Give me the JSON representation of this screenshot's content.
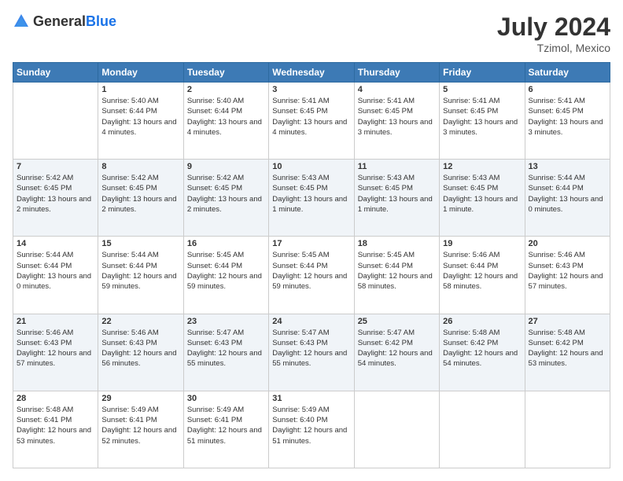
{
  "header": {
    "logo_general": "General",
    "logo_blue": "Blue",
    "month_year": "July 2024",
    "location": "Tzimol, Mexico"
  },
  "weekdays": [
    "Sunday",
    "Monday",
    "Tuesday",
    "Wednesday",
    "Thursday",
    "Friday",
    "Saturday"
  ],
  "weeks": [
    [
      {
        "day": "",
        "sunrise": "",
        "sunset": "",
        "daylight": ""
      },
      {
        "day": "1",
        "sunrise": "Sunrise: 5:40 AM",
        "sunset": "Sunset: 6:44 PM",
        "daylight": "Daylight: 13 hours and 4 minutes."
      },
      {
        "day": "2",
        "sunrise": "Sunrise: 5:40 AM",
        "sunset": "Sunset: 6:44 PM",
        "daylight": "Daylight: 13 hours and 4 minutes."
      },
      {
        "day": "3",
        "sunrise": "Sunrise: 5:41 AM",
        "sunset": "Sunset: 6:45 PM",
        "daylight": "Daylight: 13 hours and 4 minutes."
      },
      {
        "day": "4",
        "sunrise": "Sunrise: 5:41 AM",
        "sunset": "Sunset: 6:45 PM",
        "daylight": "Daylight: 13 hours and 3 minutes."
      },
      {
        "day": "5",
        "sunrise": "Sunrise: 5:41 AM",
        "sunset": "Sunset: 6:45 PM",
        "daylight": "Daylight: 13 hours and 3 minutes."
      },
      {
        "day": "6",
        "sunrise": "Sunrise: 5:41 AM",
        "sunset": "Sunset: 6:45 PM",
        "daylight": "Daylight: 13 hours and 3 minutes."
      }
    ],
    [
      {
        "day": "7",
        "sunrise": "Sunrise: 5:42 AM",
        "sunset": "Sunset: 6:45 PM",
        "daylight": "Daylight: 13 hours and 2 minutes."
      },
      {
        "day": "8",
        "sunrise": "Sunrise: 5:42 AM",
        "sunset": "Sunset: 6:45 PM",
        "daylight": "Daylight: 13 hours and 2 minutes."
      },
      {
        "day": "9",
        "sunrise": "Sunrise: 5:42 AM",
        "sunset": "Sunset: 6:45 PM",
        "daylight": "Daylight: 13 hours and 2 minutes."
      },
      {
        "day": "10",
        "sunrise": "Sunrise: 5:43 AM",
        "sunset": "Sunset: 6:45 PM",
        "daylight": "Daylight: 13 hours and 1 minute."
      },
      {
        "day": "11",
        "sunrise": "Sunrise: 5:43 AM",
        "sunset": "Sunset: 6:45 PM",
        "daylight": "Daylight: 13 hours and 1 minute."
      },
      {
        "day": "12",
        "sunrise": "Sunrise: 5:43 AM",
        "sunset": "Sunset: 6:45 PM",
        "daylight": "Daylight: 13 hours and 1 minute."
      },
      {
        "day": "13",
        "sunrise": "Sunrise: 5:44 AM",
        "sunset": "Sunset: 6:44 PM",
        "daylight": "Daylight: 13 hours and 0 minutes."
      }
    ],
    [
      {
        "day": "14",
        "sunrise": "Sunrise: 5:44 AM",
        "sunset": "Sunset: 6:44 PM",
        "daylight": "Daylight: 13 hours and 0 minutes."
      },
      {
        "day": "15",
        "sunrise": "Sunrise: 5:44 AM",
        "sunset": "Sunset: 6:44 PM",
        "daylight": "Daylight: 12 hours and 59 minutes."
      },
      {
        "day": "16",
        "sunrise": "Sunrise: 5:45 AM",
        "sunset": "Sunset: 6:44 PM",
        "daylight": "Daylight: 12 hours and 59 minutes."
      },
      {
        "day": "17",
        "sunrise": "Sunrise: 5:45 AM",
        "sunset": "Sunset: 6:44 PM",
        "daylight": "Daylight: 12 hours and 59 minutes."
      },
      {
        "day": "18",
        "sunrise": "Sunrise: 5:45 AM",
        "sunset": "Sunset: 6:44 PM",
        "daylight": "Daylight: 12 hours and 58 minutes."
      },
      {
        "day": "19",
        "sunrise": "Sunrise: 5:46 AM",
        "sunset": "Sunset: 6:44 PM",
        "daylight": "Daylight: 12 hours and 58 minutes."
      },
      {
        "day": "20",
        "sunrise": "Sunrise: 5:46 AM",
        "sunset": "Sunset: 6:43 PM",
        "daylight": "Daylight: 12 hours and 57 minutes."
      }
    ],
    [
      {
        "day": "21",
        "sunrise": "Sunrise: 5:46 AM",
        "sunset": "Sunset: 6:43 PM",
        "daylight": "Daylight: 12 hours and 57 minutes."
      },
      {
        "day": "22",
        "sunrise": "Sunrise: 5:46 AM",
        "sunset": "Sunset: 6:43 PM",
        "daylight": "Daylight: 12 hours and 56 minutes."
      },
      {
        "day": "23",
        "sunrise": "Sunrise: 5:47 AM",
        "sunset": "Sunset: 6:43 PM",
        "daylight": "Daylight: 12 hours and 55 minutes."
      },
      {
        "day": "24",
        "sunrise": "Sunrise: 5:47 AM",
        "sunset": "Sunset: 6:43 PM",
        "daylight": "Daylight: 12 hours and 55 minutes."
      },
      {
        "day": "25",
        "sunrise": "Sunrise: 5:47 AM",
        "sunset": "Sunset: 6:42 PM",
        "daylight": "Daylight: 12 hours and 54 minutes."
      },
      {
        "day": "26",
        "sunrise": "Sunrise: 5:48 AM",
        "sunset": "Sunset: 6:42 PM",
        "daylight": "Daylight: 12 hours and 54 minutes."
      },
      {
        "day": "27",
        "sunrise": "Sunrise: 5:48 AM",
        "sunset": "Sunset: 6:42 PM",
        "daylight": "Daylight: 12 hours and 53 minutes."
      }
    ],
    [
      {
        "day": "28",
        "sunrise": "Sunrise: 5:48 AM",
        "sunset": "Sunset: 6:41 PM",
        "daylight": "Daylight: 12 hours and 53 minutes."
      },
      {
        "day": "29",
        "sunrise": "Sunrise: 5:49 AM",
        "sunset": "Sunset: 6:41 PM",
        "daylight": "Daylight: 12 hours and 52 minutes."
      },
      {
        "day": "30",
        "sunrise": "Sunrise: 5:49 AM",
        "sunset": "Sunset: 6:41 PM",
        "daylight": "Daylight: 12 hours and 51 minutes."
      },
      {
        "day": "31",
        "sunrise": "Sunrise: 5:49 AM",
        "sunset": "Sunset: 6:40 PM",
        "daylight": "Daylight: 12 hours and 51 minutes."
      },
      {
        "day": "",
        "sunrise": "",
        "sunset": "",
        "daylight": ""
      },
      {
        "day": "",
        "sunrise": "",
        "sunset": "",
        "daylight": ""
      },
      {
        "day": "",
        "sunrise": "",
        "sunset": "",
        "daylight": ""
      }
    ]
  ]
}
